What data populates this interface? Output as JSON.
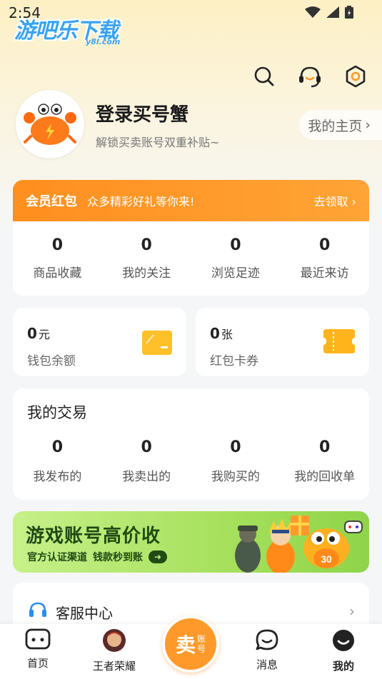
{
  "status_bar": {
    "time": "2:54"
  },
  "watermark": {
    "text": "游吧乐下载",
    "sub": "y8l.com"
  },
  "header": {
    "icons": [
      "search-icon",
      "headset-icon",
      "settings-icon"
    ]
  },
  "profile": {
    "title": "登录买号蟹",
    "subtitle": "解锁买卖账号双重补贴~",
    "homepage_label": "我的主页",
    "homepage_arrow": "›"
  },
  "vip": {
    "badge": "会员红包",
    "text": "众多精彩好礼等你来!",
    "action": "去领取",
    "action_arrow": "›",
    "stats": [
      {
        "value": "0",
        "label": "商品收藏"
      },
      {
        "value": "0",
        "label": "我的关注"
      },
      {
        "value": "0",
        "label": "浏览足迹"
      },
      {
        "value": "0",
        "label": "最近来访"
      }
    ]
  },
  "wallet": {
    "value": "0",
    "unit": "元",
    "label": "钱包余额"
  },
  "coupon": {
    "value": "0",
    "unit": "张",
    "label": "红包卡券"
  },
  "trade": {
    "title": "我的交易",
    "stats": [
      {
        "value": "0",
        "label": "我发布的"
      },
      {
        "value": "0",
        "label": "我卖出的"
      },
      {
        "value": "0",
        "label": "我购买的"
      },
      {
        "value": "0",
        "label": "我的回收单"
      }
    ]
  },
  "banner": {
    "title": "游戏账号高价收",
    "sub1": "官方认证渠道",
    "sub2": "钱款秒到账",
    "go_arrow": "➜",
    "jersey_number": "30"
  },
  "service": {
    "label": "客服中心",
    "arrow": "›"
  },
  "tabbar": {
    "tabs": [
      {
        "label": "首页"
      },
      {
        "label": "王者荣耀"
      },
      {
        "label": "消息"
      },
      {
        "label": "我的"
      }
    ],
    "sell": {
      "main": "卖",
      "side1": "账",
      "side2": "号"
    }
  },
  "colors": {
    "accent": "#ff9a2a",
    "vip_banner": "#ff8f1f",
    "banner_green": "#a6e05c"
  }
}
